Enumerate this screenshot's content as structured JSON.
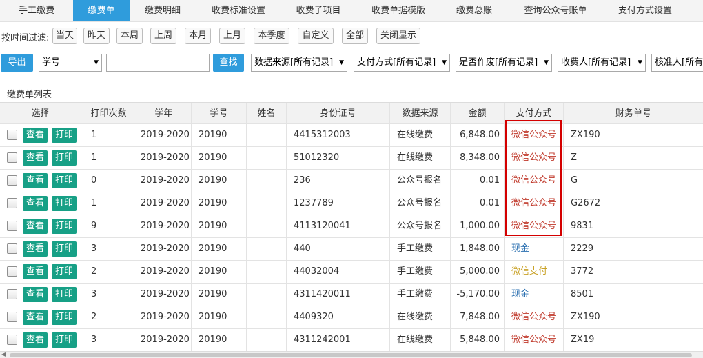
{
  "nav": {
    "tabs": [
      {
        "label": "手工缴费",
        "active": false
      },
      {
        "label": "缴费单",
        "active": true
      },
      {
        "label": "缴费明细",
        "active": false
      },
      {
        "label": "收费标准设置",
        "active": false
      },
      {
        "label": "收费子项目",
        "active": false
      },
      {
        "label": "收费单据模版",
        "active": false
      },
      {
        "label": "缴费总账",
        "active": false
      },
      {
        "label": "查询公众号账单",
        "active": false
      },
      {
        "label": "支付方式设置",
        "active": false
      }
    ]
  },
  "filter": {
    "label": "按时间过滤:",
    "buttons": [
      "当天",
      "昨天",
      "本周",
      "上周",
      "本月",
      "上月",
      "本季度",
      "自定义",
      "全部",
      "关闭显示"
    ]
  },
  "toolbar": {
    "export_label": "导出",
    "search_field": "学号",
    "search_value": "",
    "search_button": "查找",
    "data_source": "数据来源[所有记录]",
    "pay_method": "支付方式[所有记录]",
    "voided": "是否作废[所有记录]",
    "payee": "收费人[所有记录]",
    "approver": "核准人[所有"
  },
  "list_title": "缴费单列表",
  "table": {
    "headers": [
      "选择",
      "打印次数",
      "学年",
      "学号",
      "姓名",
      "身份证号",
      "数据来源",
      "金额",
      "支付方式",
      "财务单号"
    ],
    "view_label": "查看",
    "print_label": "打印",
    "rows": [
      {
        "print_count": "1",
        "year": "2019-2020",
        "student_no": "20190",
        "name": "",
        "id_no": "4415312003",
        "source": "在线缴费",
        "amount": "6,848.00",
        "pay": "微信公众号",
        "pay_type": "wechat",
        "fin_no": "ZX190"
      },
      {
        "print_count": "1",
        "year": "2019-2020",
        "student_no": "20190",
        "name": "",
        "id_no": "51012320",
        "source": "在线缴费",
        "amount": "8,348.00",
        "pay": "微信公众号",
        "pay_type": "wechat",
        "fin_no": "Z"
      },
      {
        "print_count": "0",
        "year": "2019-2020",
        "student_no": "20190",
        "name": "",
        "id_no": "236",
        "source": "公众号报名",
        "amount": "0.01",
        "pay": "微信公众号",
        "pay_type": "wechat",
        "fin_no": "G"
      },
      {
        "print_count": "1",
        "year": "2019-2020",
        "student_no": "20190",
        "name": "",
        "id_no": "1237789",
        "source": "公众号报名",
        "amount": "0.01",
        "pay": "微信公众号",
        "pay_type": "wechat",
        "fin_no": "G2672"
      },
      {
        "print_count": "9",
        "year": "2019-2020",
        "student_no": "20190",
        "name": "",
        "id_no": "4113120041",
        "source": "公众号报名",
        "amount": "1,000.00",
        "pay": "微信公众号",
        "pay_type": "wechat",
        "fin_no": "9831"
      },
      {
        "print_count": "3",
        "year": "2019-2020",
        "student_no": "20190",
        "name": "",
        "id_no": "440",
        "source": "手工缴费",
        "amount": "1,848.00",
        "pay": "现金",
        "pay_type": "cash",
        "fin_no": "2229"
      },
      {
        "print_count": "2",
        "year": "2019-2020",
        "student_no": "20190",
        "name": "",
        "id_no": "44032004",
        "source": "手工缴费",
        "amount": "5,000.00",
        "pay": "微信支付",
        "pay_type": "wxpay",
        "fin_no": "3772"
      },
      {
        "print_count": "3",
        "year": "2019-2020",
        "student_no": "20190",
        "name": "",
        "id_no": "4311420011",
        "source": "手工缴费",
        "amount": "-5,170.00",
        "pay": "现金",
        "pay_type": "cash",
        "fin_no": "8501"
      },
      {
        "print_count": "2",
        "year": "2019-2020",
        "student_no": "20190",
        "name": "",
        "id_no": "4409320",
        "source": "在线缴费",
        "amount": "7,848.00",
        "pay": "微信公众号",
        "pay_type": "wechat",
        "fin_no": "ZX190"
      },
      {
        "print_count": "3",
        "year": "2019-2020",
        "student_no": "20190",
        "name": "",
        "id_no": "4311242001",
        "source": "在线缴费",
        "amount": "5,848.00",
        "pay": "微信公众号",
        "pay_type": "wechat",
        "fin_no": "ZX19"
      }
    ]
  },
  "colors": {
    "accent": "#2f9cdc",
    "action_green": "#17a086",
    "highlight_red": "#d40000"
  }
}
